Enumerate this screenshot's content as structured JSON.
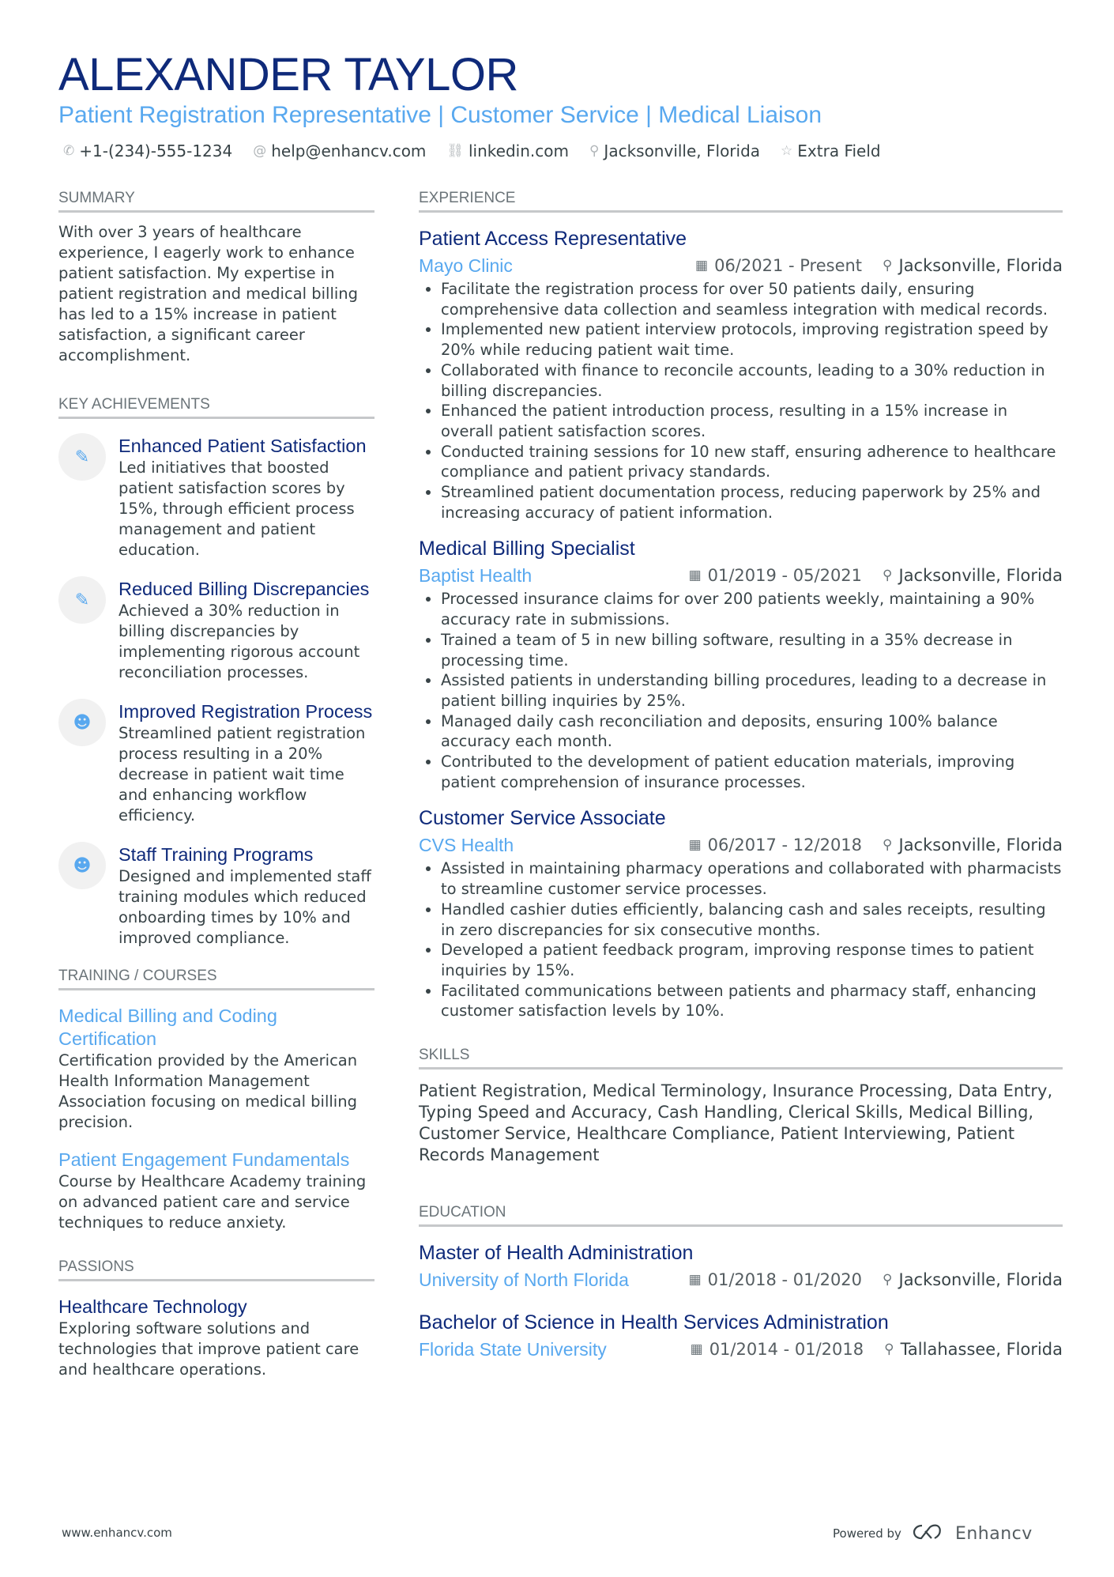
{
  "header": {
    "name": "ALEXANDER TAYLOR",
    "headline": "Patient Registration Representative | Customer Service | Medical Liaison",
    "contacts": [
      {
        "icon": "phone-icon",
        "glyph": "✆",
        "text": "+1-(234)-555-1234"
      },
      {
        "icon": "email-icon",
        "glyph": "@",
        "text": "help@enhancv.com"
      },
      {
        "icon": "link-icon",
        "glyph": "⛓",
        "text": "linkedin.com"
      },
      {
        "icon": "location-icon",
        "glyph": "⚲",
        "text": "Jacksonville, Florida"
      },
      {
        "icon": "star-icon",
        "glyph": "☆",
        "text": "Extra Field"
      }
    ]
  },
  "summary": {
    "title": "SUMMARY",
    "text": "With over 3 years of healthcare experience, I eagerly work to enhance patient satisfaction. My expertise in patient registration and medical billing has led to a 15% increase in patient satisfaction, a significant career accomplishment."
  },
  "achievements": {
    "title": "KEY ACHIEVEMENTS",
    "items": [
      {
        "icon": "magic-wand-icon",
        "glyph": "✎",
        "title": "Enhanced Patient Satisfaction",
        "desc": "Led initiatives that boosted patient satisfaction scores by 15%, through efficient process management and patient education."
      },
      {
        "icon": "magic-wand-icon",
        "glyph": "✎",
        "title": "Reduced Billing Discrepancies",
        "desc": "Achieved a 30% reduction in billing discrepancies by implementing rigorous account reconciliation processes."
      },
      {
        "icon": "head-brain-icon",
        "glyph": "☻",
        "title": "Improved Registration Process",
        "desc": "Streamlined patient registration process resulting in a 20% decrease in patient wait time and enhancing workflow efficiency."
      },
      {
        "icon": "head-brain-icon",
        "glyph": "☻",
        "title": "Staff Training Programs",
        "desc": "Designed and implemented staff training modules which reduced onboarding times by 10% and improved compliance."
      }
    ]
  },
  "training": {
    "title": "TRAINING / COURSES",
    "items": [
      {
        "title": "Medical Billing and Coding Certification",
        "desc": "Certification provided by the American Health Information Management Association focusing on medical billing precision."
      },
      {
        "title": "Patient Engagement Fundamentals",
        "desc": "Course by Healthcare Academy training on advanced patient care and service techniques to reduce anxiety."
      }
    ]
  },
  "passions": {
    "title": "PASSIONS",
    "items": [
      {
        "title": "Healthcare Technology",
        "desc": "Exploring software solutions and technologies that improve patient care and healthcare operations."
      }
    ]
  },
  "experience": {
    "title": "EXPERIENCE",
    "jobs": [
      {
        "title": "Patient Access Representative",
        "company": "Mayo Clinic",
        "dates": "06/2021 - Present",
        "location": "Jacksonville, Florida",
        "bullets": [
          "Facilitate the registration process for over 50 patients daily, ensuring comprehensive data collection and seamless integration with medical records.",
          "Implemented new patient interview protocols, improving registration speed by 20% while reducing patient wait time.",
          "Collaborated with finance to reconcile accounts, leading to a 30% reduction in billing discrepancies.",
          "Enhanced the patient introduction process, resulting in a 15% increase in overall patient satisfaction scores.",
          "Conducted training sessions for 10 new staff, ensuring adherence to healthcare compliance and patient privacy standards.",
          "Streamlined patient documentation process, reducing paperwork by 25% and increasing accuracy of patient information."
        ]
      },
      {
        "title": "Medical Billing Specialist",
        "company": "Baptist Health",
        "dates": "01/2019 - 05/2021",
        "location": "Jacksonville, Florida",
        "bullets": [
          "Processed insurance claims for over 200 patients weekly, maintaining a 90% accuracy rate in submissions.",
          "Trained a team of 5 in new billing software, resulting in a 35% decrease in processing time.",
          "Assisted patients in understanding billing procedures, leading to a decrease in patient billing inquiries by 25%.",
          "Managed daily cash reconciliation and deposits, ensuring 100% balance accuracy each month.",
          "Contributed to the development of patient education materials, improving patient comprehension of insurance processes."
        ]
      },
      {
        "title": "Customer Service Associate",
        "company": "CVS Health",
        "dates": "06/2017 - 12/2018",
        "location": "Jacksonville, Florida",
        "bullets": [
          "Assisted in maintaining pharmacy operations and collaborated with pharmacists to streamline customer service processes.",
          "Handled cashier duties efficiently, balancing cash and sales receipts, resulting in zero discrepancies for six consecutive months.",
          "Developed a patient feedback program, improving response times to patient inquiries by 15%.",
          "Facilitated communications between patients and pharmacy staff, enhancing customer satisfaction levels by 10%."
        ]
      }
    ]
  },
  "skills": {
    "title": "SKILLS",
    "text": "Patient Registration, Medical Terminology, Insurance Processing, Data Entry, Typing Speed and Accuracy, Cash Handling, Clerical Skills, Medical Billing, Customer Service, Healthcare Compliance, Patient Interviewing, Patient Records Management"
  },
  "education": {
    "title": "EDUCATION",
    "items": [
      {
        "degree": "Master of Health Administration",
        "school": "University of North Florida",
        "dates": "01/2018 - 01/2020",
        "location": "Jacksonville, Florida"
      },
      {
        "degree": "Bachelor of Science in Health Services Administration",
        "school": "Florida State University",
        "dates": "01/2014 - 01/2018",
        "location": "Tallahassee, Florida"
      }
    ]
  },
  "footer": {
    "website": "www.enhancv.com",
    "powered_by": "Powered by",
    "brand": "Enhancv"
  },
  "colors": {
    "name": "#0f2a7a",
    "accent": "#58a8ef",
    "text": "#384347",
    "rule": "#c6c8ca"
  }
}
